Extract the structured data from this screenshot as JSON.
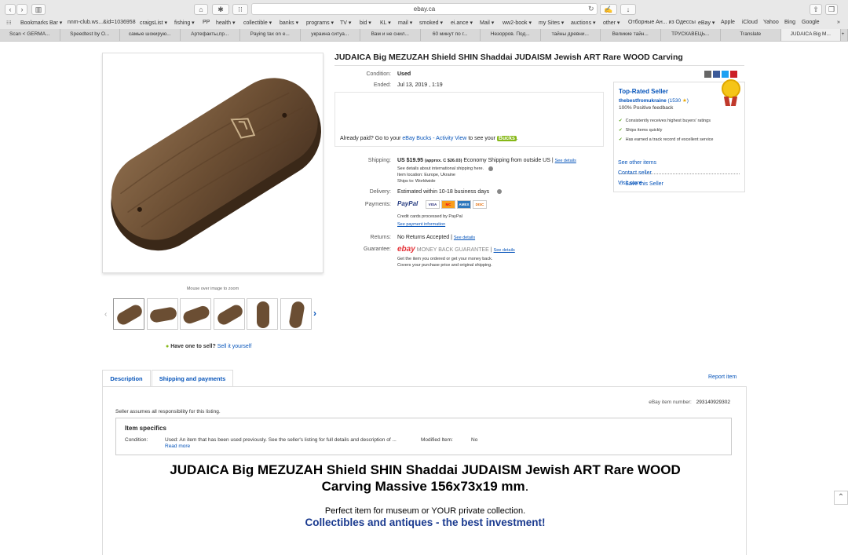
{
  "browser": {
    "url": "ebay.ca",
    "bookmarks": [
      "Bookmarks Bar ▾",
      "nnm-club.ws...&id=1036958",
      "craigsList ▾",
      "fishing ▾",
      "PP",
      "health ▾",
      "collectible ▾",
      "banks ▾",
      "programs ▾",
      "TV ▾",
      "bid ▾",
      "KL ▾",
      "mail ▾",
      "smoked ▾",
      "ei.ance ▾",
      "Mail ▾",
      "ww2-book ▾",
      "my Sites ▾",
      "auctions ▾",
      "other ▾",
      "Отборные Ан... из Одессы",
      "eBay ▾",
      "Apple",
      "iCloud",
      "Yahoo",
      "Bing",
      "Google"
    ],
    "tabs": [
      "Scan < GERMA...",
      "Speedtest by O...",
      "самые шокирую...",
      "Артефакты,пр...",
      "Paying tax on e...",
      "украина ситуа...",
      "Вам и не снил...",
      "60 минут по г...",
      "Незорров. Под...",
      "тайны древни...",
      "Великие тайн...",
      "ТРУСКАВЕЦЬ...",
      "Translate",
      "JUDAICA Big M..."
    ]
  },
  "listing": {
    "title": "JUDAICA Big MEZUZAH Shield SHIN Shaddai JUDAISM Jewish ART Rare WOOD Carving",
    "condition_label": "Condition:",
    "condition": "Used",
    "ended_label": "Ended:",
    "ended": "Jul 13, 2019 , 1:19",
    "already_paid_prefix": "Already paid? Go to your",
    "already_paid_link": "eBay Bucks - Activity View",
    "already_paid_suffix": "to see your",
    "bucks_badge": "Bucks",
    "shipping_label": "Shipping:",
    "shipping_price": "US $19.95",
    "shipping_approx": "(approx. C $26.03)",
    "shipping_method": "Economy Shipping from outside US |",
    "see_details": "See details",
    "intl_details": "See details about international shipping here.",
    "item_location": "Item location: Europe, Ukraine",
    "ships_to": "Ships to: Worldwide",
    "delivery_label": "Delivery:",
    "delivery": "Estimated within 10-18 business days",
    "payments_label": "Payments:",
    "paypal": "PayPal",
    "cards": [
      "VISA",
      "MC",
      "AMEX",
      "DISC"
    ],
    "credit_note": "Credit cards processed by PayPal",
    "see_payment": "See payment information",
    "returns_label": "Returns:",
    "returns": "No Returns Accepted |",
    "guarantee_label": "Guarantee:",
    "guarantee_logo": "ebay",
    "guarantee_text": "MONEY BACK GUARANTEE",
    "guarantee_line1": "Get the item you ordered or get your money back.",
    "guarantee_line2": "Covers your purchase price and original shipping.",
    "zoom_hint": "Mouse over image to zoom",
    "sell_prompt": "Have one to sell?",
    "sell_link": "Sell it yourself"
  },
  "seller": {
    "heading": "Top-Rated Seller",
    "name": "thebestfromukraine",
    "score": "(1530",
    "score_close": ")",
    "feedback": "100% Positive feedback",
    "bullets": [
      "Consistently receives highest buyers' ratings",
      "Ships items quickly",
      "Has earned a track record of excellent service"
    ],
    "save": "Save this Seller",
    "other": "See other items",
    "contact": "Contact seller",
    "visit": "Visit store"
  },
  "desc": {
    "tab_description": "Description",
    "tab_shipping": "Shipping and payments",
    "report": "Report item",
    "item_number_label": "eBay item number:",
    "item_number": "293140929302",
    "responsibility": "Seller assumes all responsibility for this listing.",
    "specifics_heading": "Item specifics",
    "condition_label": "Condition:",
    "condition_text": "Used: An item that has been used previously. See the seller's listing for full details and description of ...",
    "read_more": "Read more",
    "modified_label": "Modified Item:",
    "modified_value": "No",
    "big_title_line1": "JUDAICA Big MEZUZAH Shield SHIN Shaddai JUDAISM Jewish ART Rare WOOD",
    "big_title_line2": "Carving Massive 156x73x19 mm",
    "big_title_period": ".",
    "subtitle": "Perfect item for museum or YOUR private collection.",
    "tagline": "Collectibles and antiques - the best investment!"
  }
}
